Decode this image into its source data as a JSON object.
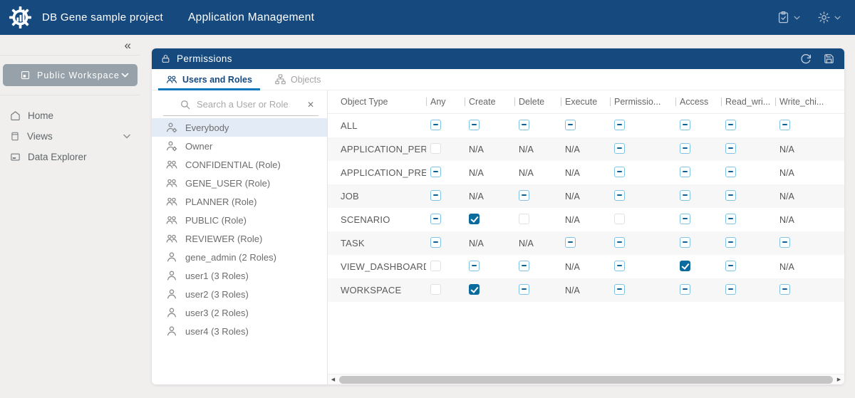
{
  "topbar": {
    "project_title": "DB Gene sample project",
    "page_title": "Application Management"
  },
  "sidebar": {
    "collapse_glyph": "«",
    "workspace_button": {
      "label": "Public Workspace"
    },
    "items": [
      {
        "label": "Home"
      },
      {
        "label": "Views"
      },
      {
        "label": "Data Explorer"
      }
    ]
  },
  "panel": {
    "title": "Permissions",
    "tabs": [
      {
        "label": "Users and Roles",
        "active": true
      },
      {
        "label": "Objects",
        "active": false
      }
    ],
    "search": {
      "placeholder": "Search a User or Role",
      "clear_glyph": "✕"
    },
    "principals": [
      {
        "label": "Everybody",
        "type": "admin",
        "selected": true
      },
      {
        "label": "Owner",
        "type": "admin",
        "selected": false
      },
      {
        "label": "CONFIDENTIAL (Role)",
        "type": "role",
        "selected": false
      },
      {
        "label": "GENE_USER (Role)",
        "type": "role",
        "selected": false
      },
      {
        "label": "PLANNER (Role)",
        "type": "role",
        "selected": false
      },
      {
        "label": "PUBLIC (Role)",
        "type": "role",
        "selected": false
      },
      {
        "label": "REVIEWER (Role)",
        "type": "role",
        "selected": false
      },
      {
        "label": "gene_admin (2 Roles)",
        "type": "user",
        "selected": false
      },
      {
        "label": "user1 (3 Roles)",
        "type": "user",
        "selected": false
      },
      {
        "label": "user2 (3 Roles)",
        "type": "user",
        "selected": false
      },
      {
        "label": "user3 (2 Roles)",
        "type": "user",
        "selected": false
      },
      {
        "label": "user4 (3 Roles)",
        "type": "user",
        "selected": false
      }
    ],
    "table": {
      "columns": [
        "Object Type",
        "Any",
        "Create",
        "Delete",
        "Execute",
        "Permissio...",
        "Access",
        "Read_wri...",
        "Write_chi..."
      ],
      "na_label": "N/A",
      "rows": [
        {
          "object_type": "ALL",
          "cells": [
            "indeterminate",
            "indeterminate",
            "indeterminate",
            "indeterminate",
            "indeterminate",
            "indeterminate",
            "indeterminate",
            "indeterminate"
          ]
        },
        {
          "object_type": "APPLICATION_PERMISSION",
          "cells": [
            "unchecked",
            "na",
            "na",
            "na",
            "indeterminate",
            "indeterminate",
            "indeterminate",
            "na"
          ]
        },
        {
          "object_type": "APPLICATION_PREFERENCE",
          "cells": [
            "indeterminate",
            "na",
            "na",
            "na",
            "indeterminate",
            "indeterminate",
            "indeterminate",
            "na"
          ]
        },
        {
          "object_type": "JOB",
          "cells": [
            "indeterminate",
            "na",
            "indeterminate",
            "na",
            "indeterminate",
            "indeterminate",
            "indeterminate",
            "na"
          ]
        },
        {
          "object_type": "SCENARIO",
          "cells": [
            "indeterminate",
            "checked",
            "unchecked",
            "na",
            "unchecked",
            "indeterminate",
            "indeterminate",
            "na"
          ]
        },
        {
          "object_type": "TASK",
          "cells": [
            "indeterminate",
            "na",
            "na",
            "indeterminate",
            "indeterminate",
            "indeterminate",
            "indeterminate",
            "indeterminate"
          ]
        },
        {
          "object_type": "VIEW_DASHBOARD",
          "cells": [
            "unchecked",
            "indeterminate",
            "indeterminate",
            "na",
            "indeterminate",
            "checked",
            "indeterminate",
            "na"
          ]
        },
        {
          "object_type": "WORKSPACE",
          "cells": [
            "unchecked",
            "checked",
            "indeterminate",
            "na",
            "indeterminate",
            "indeterminate",
            "indeterminate",
            "indeterminate"
          ]
        }
      ]
    }
  },
  "scrollbar": {
    "left_glyph": "◀",
    "right_glyph": "▶"
  },
  "icons": [
    "dbgene-logo",
    "clipboard-check-icon",
    "gear-icon",
    "chevron-down-icon",
    "workspace-icon",
    "home-icon",
    "views-icon",
    "data-explorer-icon",
    "lock-icon",
    "refresh-icon",
    "save-icon",
    "users-group-icon",
    "objects-hierarchy-icon",
    "search-icon",
    "close-icon",
    "admin-user-icon",
    "role-group-icon",
    "user-icon"
  ],
  "colors": {
    "topbar_bg": "#164a7e",
    "tab_accent": "#1276bc",
    "checkbox_checked": "#0c6b9d",
    "checkbox_indeterminate_border": "#7fc3e6",
    "selected_item_bg": "#e2ebf6",
    "workspace_button_bg": "#96a1a9",
    "page_bg": "#f1efee"
  }
}
